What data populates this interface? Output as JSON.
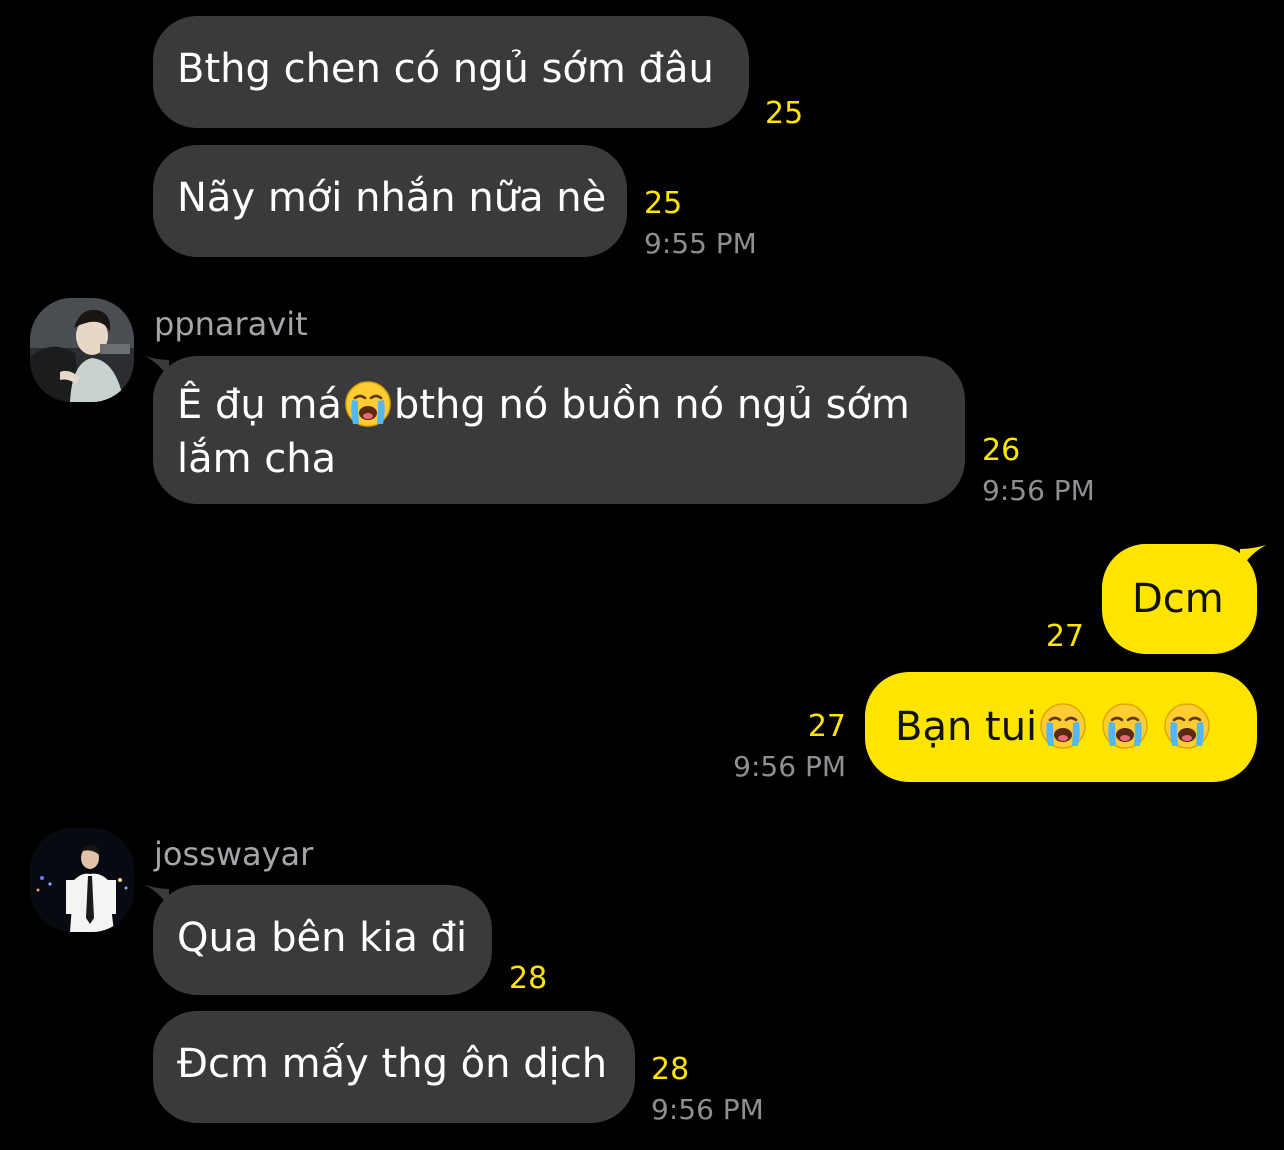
{
  "colors": {
    "background": "#000000",
    "incoming_bubble": "#3a3a3c",
    "outgoing_bubble": "#fee500",
    "unread_count": "#fee500",
    "timestamp": "#8e8e93"
  },
  "messages": {
    "m1": {
      "text": "Bthg chen có ngủ sớm đâu",
      "unread": "25"
    },
    "m2": {
      "text": "Nãy mới nhắn nữa nè",
      "unread": "25",
      "time": "9:55 PM"
    },
    "group2": {
      "sender": "ppnaravit",
      "avatar_icon": "user-photo-avatar",
      "m3": {
        "before_emoji": "Ê đụ má",
        "emoji": "loudly-crying-face-icon",
        "after_emoji": "bthg nó buồn nó ngủ sớm lắm cha",
        "unread": "26",
        "time": "9:56 PM"
      }
    },
    "outgoing": {
      "m4": {
        "text": "Dcm",
        "unread": "27"
      },
      "m5": {
        "text": "Bạn tui",
        "emoji": "loudly-crying-face-icon",
        "emoji_count": 3,
        "unread": "27",
        "time": "9:56 PM"
      }
    },
    "group3": {
      "sender": "josswayar",
      "avatar_icon": "user-photo-avatar",
      "m6": {
        "text": "Qua bên kia đi",
        "unread": "28"
      },
      "m7": {
        "text": "Đcm mấy thg ôn dịch",
        "unread": "28",
        "time": "9:56 PM"
      }
    }
  }
}
